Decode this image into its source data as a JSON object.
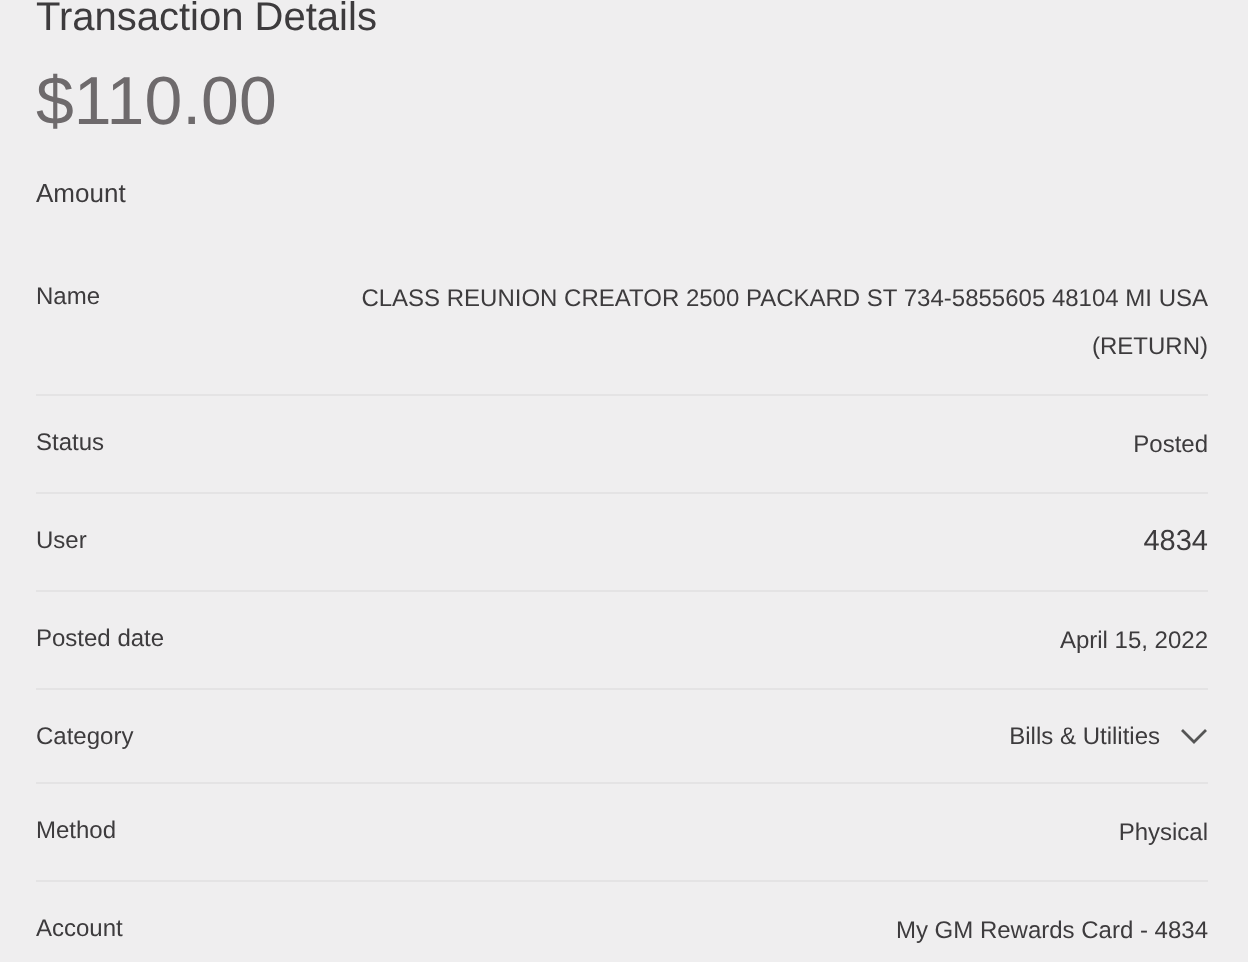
{
  "title": "Transaction Details",
  "amount": "$110.00",
  "amount_label": "Amount",
  "rows": [
    {
      "label": "Name",
      "value": "CLASS REUNION CREATOR 2500 PACKARD ST 734-5855605 48104 MI USA (RETURN)",
      "kind": "text"
    },
    {
      "label": "Status",
      "value": "Posted",
      "kind": "text"
    },
    {
      "label": "User",
      "value": "4834",
      "kind": "large"
    },
    {
      "label": "Posted date",
      "value": "April 15, 2022",
      "kind": "text"
    },
    {
      "label": "Category",
      "value": "Bills & Utilities",
      "kind": "dropdown"
    },
    {
      "label": "Method",
      "value": "Physical",
      "kind": "text"
    },
    {
      "label": "Account",
      "value": "My GM Rewards Card - 4834",
      "kind": "text"
    }
  ]
}
